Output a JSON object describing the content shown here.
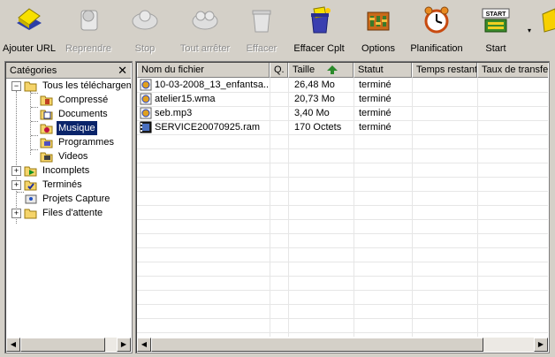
{
  "toolbar": {
    "buttons": [
      {
        "label": "Ajouter URL",
        "icon": "add-url-icon",
        "enabled": true
      },
      {
        "label": "Reprendre",
        "icon": "resume-icon",
        "enabled": false
      },
      {
        "label": "Stop",
        "icon": "stop-icon",
        "enabled": false
      },
      {
        "label": "Tout arrêter",
        "icon": "stop-all-icon",
        "enabled": false
      },
      {
        "label": "Effacer",
        "icon": "delete-icon",
        "enabled": false
      },
      {
        "label": "Effacer Cplt",
        "icon": "delete-completed-icon",
        "enabled": true
      },
      {
        "label": "Options",
        "icon": "options-icon",
        "enabled": true
      },
      {
        "label": "Planification",
        "icon": "scheduler-icon",
        "enabled": true
      },
      {
        "label": "Start",
        "icon": "start-queue-icon",
        "enabled": true
      }
    ],
    "overflow_arrow": "▾"
  },
  "categories": {
    "title": "Catégories",
    "close": "✕",
    "tree": [
      {
        "label": "Tous les téléchargements",
        "level": 0,
        "expander": "−",
        "icon": "folder-open-icon"
      },
      {
        "label": "Compressé",
        "level": 1,
        "icon": "compressed-icon"
      },
      {
        "label": "Documents",
        "level": 1,
        "icon": "documents-icon"
      },
      {
        "label": "Musique",
        "level": 1,
        "icon": "music-icon",
        "selected": true
      },
      {
        "label": "Programmes",
        "level": 1,
        "icon": "programs-icon"
      },
      {
        "label": "Videos",
        "level": 1,
        "icon": "videos-icon"
      },
      {
        "label": "Incomplets",
        "level": 0,
        "expander": "+",
        "icon": "incomplete-icon"
      },
      {
        "label": "Terminés",
        "level": 0,
        "expander": "+",
        "icon": "finished-icon"
      },
      {
        "label": "Projets Capture",
        "level": 0,
        "icon": "capture-projects-icon"
      },
      {
        "label": "Files d'attente",
        "level": 0,
        "expander": "+",
        "icon": "queues-icon"
      }
    ]
  },
  "file_list": {
    "columns": [
      "Nom du fichier",
      "Q.",
      "Taille",
      "Statut",
      "Temps restant",
      "Taux de transfert"
    ],
    "rows": [
      {
        "name": "10-03-2008_13_enfantsa...",
        "q": "",
        "size": "26,48  Mo",
        "status": "terminé",
        "icon": "audio-file-icon"
      },
      {
        "name": "atelier15.wma",
        "q": "",
        "size": "20,73  Mo",
        "status": "terminé",
        "icon": "audio-file-icon"
      },
      {
        "name": "seb.mp3",
        "q": "",
        "size": "3,40  Mo",
        "status": "terminé",
        "icon": "audio-file-icon"
      },
      {
        "name": "SERVICE20070925.ram",
        "q": "",
        "size": "170  Octets",
        "status": "terminé",
        "icon": "video-file-icon"
      }
    ]
  },
  "colors": {
    "selection": "#0a246a",
    "chrome": "#d4d0c8"
  }
}
